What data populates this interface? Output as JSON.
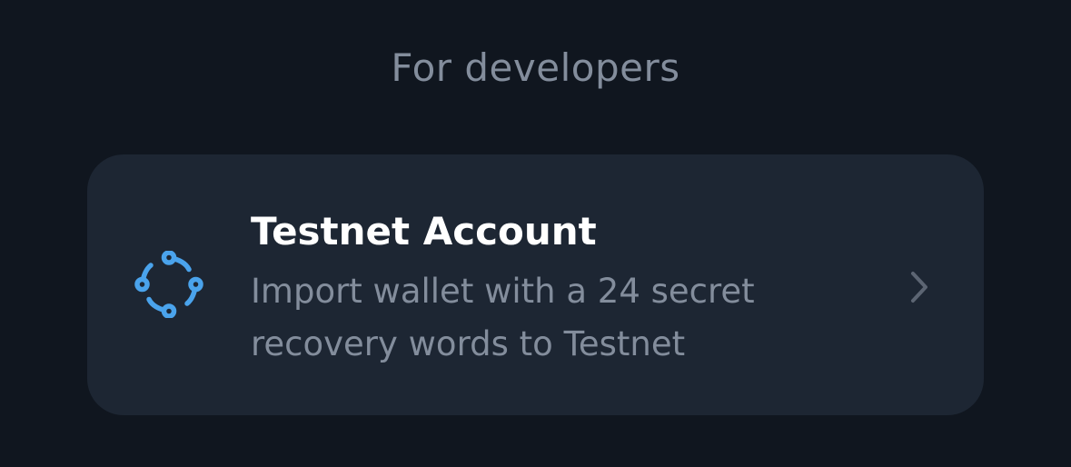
{
  "section": {
    "title": "For developers"
  },
  "testnet_card": {
    "title": "Testnet Account",
    "subtitle": "Import wallet with a 24 secret recovery words to Testnet",
    "icon": "testnet-network-icon",
    "chevron_icon": "chevron-right-icon"
  },
  "colors": {
    "background": "#10161f",
    "card": "#1d2633",
    "title_text": "#ffffff",
    "secondary_text": "#838d9c",
    "icon_accent": "#4aa3ec",
    "chevron": "#5c6573"
  }
}
